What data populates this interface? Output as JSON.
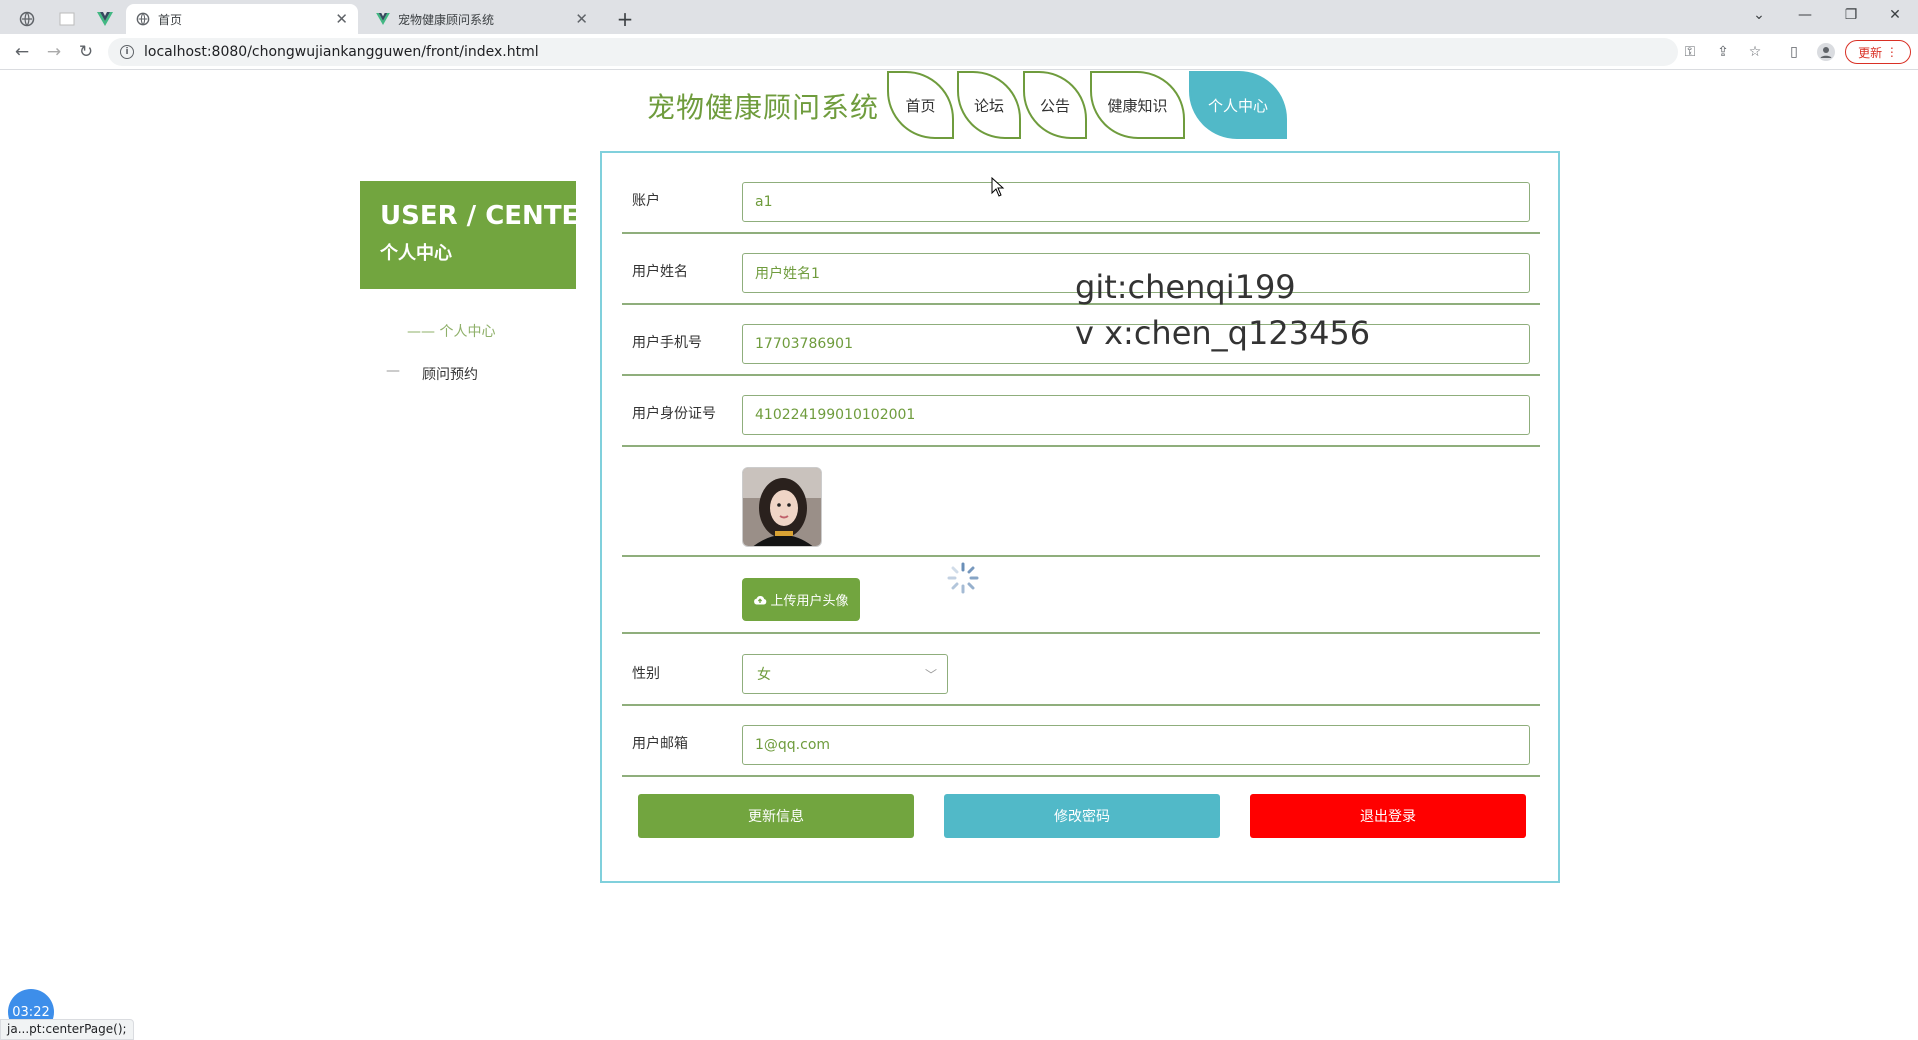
{
  "browser": {
    "tabs": [
      {
        "title": "首页",
        "icon": "globe-icon",
        "active": true
      },
      {
        "title": "宠物健康顾问系统",
        "icon": "vue-logo-icon",
        "active": false
      }
    ],
    "url": "localhost:8080/chongwujiankangguwen/front/index.html",
    "update_label": "更新"
  },
  "site": {
    "title": "宠物健康顾问系统",
    "nav": [
      "首页",
      "论坛",
      "公告",
      "健康知识",
      "个人中心"
    ],
    "active_nav": "个人中心"
  },
  "sidebar": {
    "title_en": "USER / CENTER",
    "title_cn": "个人中心",
    "items": [
      {
        "label": "—— 个人中心",
        "active": true
      },
      {
        "label": "顾问预约",
        "active": false,
        "dash": "—"
      }
    ]
  },
  "form": {
    "fields": [
      {
        "label": "账户",
        "value": "a1"
      },
      {
        "label": "用户姓名",
        "value": "用户姓名1"
      },
      {
        "label": "用户手机号",
        "value": "17703786901"
      },
      {
        "label": "用户身份证号",
        "value": "410224199010102001"
      },
      {
        "label": "用户邮箱",
        "value": "1@qq.com"
      }
    ],
    "upload_label": "上传用户头像",
    "gender_label": "性别",
    "gender_value": "女",
    "buttons": {
      "update": "更新信息",
      "change_password": "修改密码",
      "logout": "退出登录"
    }
  },
  "watermark": [
    "git:chenqi199",
    "v x:chen_q123456"
  ],
  "timer": "03:22",
  "status_bar": "ja...pt:centerPage();",
  "colors": {
    "brand_green": "#72a53f",
    "teal": "#51b9c8",
    "danger": "#ff0000"
  }
}
